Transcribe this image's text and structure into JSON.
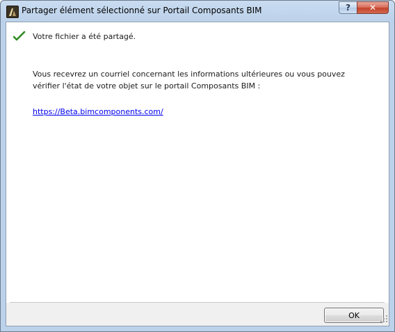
{
  "window": {
    "title": "Partager élément sélectionné sur Portail Composants BIM",
    "help_label": "?",
    "close_label": "✕"
  },
  "content": {
    "success_message": "Votre fichier a été partagé.",
    "info_message": "Vous recevrez un courriel concernant les informations ultérieures ou vous pouvez vérifier l'état de votre objet sur le portail Composants BIM :",
    "link_text": "https://Beta.bimcomponents.com/"
  },
  "footer": {
    "ok_label": "OK"
  },
  "colors": {
    "check": "#2e8b1f",
    "link": "#0000ee",
    "close_button": "#c3432b"
  },
  "icons": [
    "app-icon",
    "check-icon",
    "help-icon",
    "close-icon",
    "resize-grip-icon"
  ]
}
